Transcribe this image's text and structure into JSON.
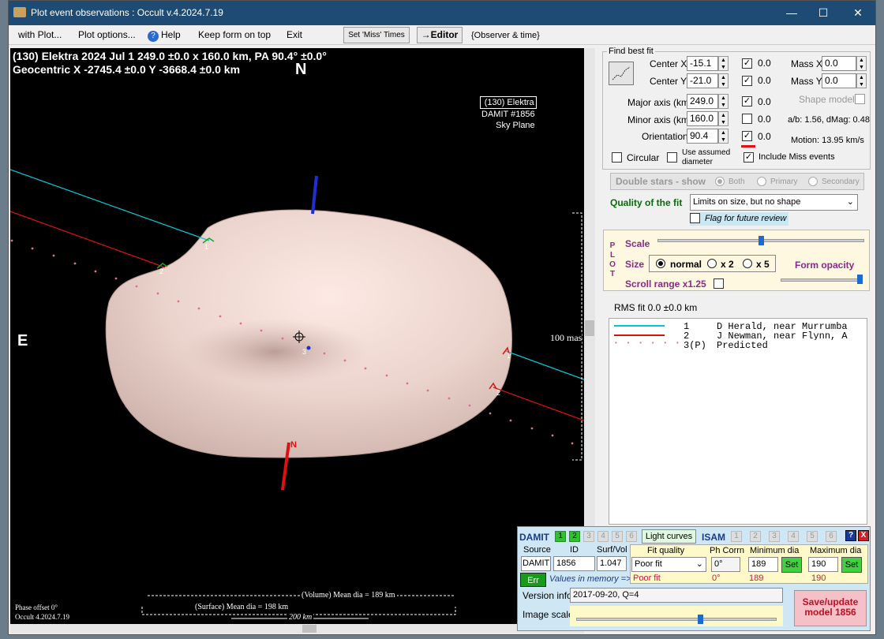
{
  "window": {
    "title": "Plot event observations : Occult v.4.2024.7.19"
  },
  "menu": {
    "with_plot": "with Plot...",
    "plot_options": "Plot options...",
    "help": "Help",
    "keep_on_top": "Keep form on top",
    "exit": "Exit",
    "set_miss": "Set 'Miss' Times",
    "editor": "→Editor",
    "observer_time": "{Observer & time}"
  },
  "plot": {
    "header1": "(130) Elektra  2024 Jul 1  249.0 ±0.0 x 160.0 km, PA 90.4° ±0.0°",
    "header2": "Geocentric  X  -2745.4 ±0.0  Y -3668.4 ±0.0 km",
    "north": "N",
    "east": "E",
    "label_box": [
      "(130) Elektra",
      "DAMIT #1856",
      "Sky Plane"
    ],
    "scale_mas": "100 mas",
    "phase_offset": "Phase offset 0°",
    "version": "Occult 4.2024.7.19",
    "volume_dia": "(Volume) Mean dia = 189 km",
    "surface_dia": "(Surface) Mean dia = 198 km",
    "scale_km": "200 km",
    "chord_labels": [
      "1",
      "2",
      "1",
      "2",
      "3"
    ],
    "small_n": "N"
  },
  "fit": {
    "title": "Find best fit",
    "center_x": {
      "label": "Center X",
      "value": "-15.1",
      "val": "0.0"
    },
    "center_y": {
      "label": "Center Y",
      "value": "-21.0",
      "val": "0.0"
    },
    "major": {
      "label": "Major axis (km)",
      "value": "249.0",
      "val": "0.0"
    },
    "minor": {
      "label": "Minor axis (km)",
      "value": "160.0",
      "val": "0.0"
    },
    "orient": {
      "label": "Orientation",
      "value": "90.4",
      "val": "0.0"
    },
    "mass_x": {
      "label": "Mass X",
      "value": "0.0"
    },
    "mass_y": {
      "label": "Mass Y",
      "value": "0.0"
    },
    "shape_model": "Shape model",
    "ab": "a/b: 1.56, dMag: 0.48",
    "motion": "Motion: 13.95 km/s",
    "circular": "Circular",
    "use_assumed": "Use assumed diameter",
    "include_miss": "Include Miss events"
  },
  "double": {
    "title": "Double stars - show",
    "both": "Both",
    "primary": "Primary",
    "secondary": "Secondary"
  },
  "quality": {
    "label": "Quality of the fit",
    "value": "Limits on size, but no shape",
    "flag": "Flag for future review"
  },
  "plotctl": {
    "side": "P L O T",
    "scale": "Scale",
    "size": "Size",
    "normal": "normal",
    "x2": "x 2",
    "x5": "x 5",
    "opacity": "Form opacity",
    "scroll": "Scroll range x1.25"
  },
  "rms": "RMS fit 0.0 ±0.0 km",
  "legend": [
    {
      "n": "1",
      "text": "D Herald, near Murrumba",
      "color": "#00c8d8",
      "kind": "line"
    },
    {
      "n": "2",
      "text": "J Newman, near Flynn, A",
      "color": "#e01010",
      "kind": "line"
    },
    {
      "n": "3(P)",
      "text": "Predicted",
      "color": "#e07090",
      "kind": "dots"
    }
  ],
  "damit": {
    "title": "DAMIT",
    "nums": [
      "1",
      "2",
      "3",
      "4",
      "5",
      "6"
    ],
    "light_curves": "Light curves",
    "isam": "ISAM",
    "help": "?",
    "close": "X",
    "source_h": "Source",
    "id_h": "ID",
    "surf_h": "Surf/Vol",
    "source": "DAMIT",
    "id": "1856",
    "surf": "1.047",
    "fitq_h": "Fit quality",
    "phcorr_h": "Ph Corrn",
    "mindia_h": "Minimum dia",
    "maxdia_h": "Maximum dia",
    "fitq": "Poor fit",
    "phcorr": "0°",
    "mindia": "189",
    "maxdia": "190",
    "set": "Set",
    "err": "Err",
    "mem": "Values in memory =>",
    "fitq_mem": "Poor fit",
    "phcorr_mem": "0°",
    "min_mem": "189",
    "max_mem": "190",
    "version_l": "Version info",
    "version": "2017-09-20, Q=4",
    "image_scale": "Image scale",
    "save": "Save/update model 1856"
  }
}
